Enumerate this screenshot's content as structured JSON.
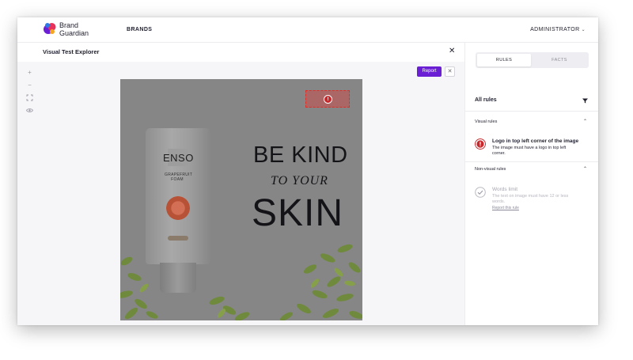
{
  "app": {
    "brand_line1": "Brand",
    "brand_line2": "Guardian",
    "nav_brands": "BRANDS",
    "nav_user": "ADMINISTRATOR"
  },
  "explorer": {
    "title": "Visual Test Explorer",
    "close_glyph": "✕",
    "report_label": "Report",
    "dismiss_glyph": "✕",
    "zoom_tools": [
      "+",
      "−",
      "⛶",
      "👁"
    ]
  },
  "image": {
    "hotspot_badge": "!",
    "headline_1": "BE KIND",
    "headline_2": "TO YOUR",
    "headline_3": "SKIN",
    "product_brand": "ENSO",
    "product_sub": "GRAPEFRUIT FOAM"
  },
  "panel": {
    "tabs": [
      {
        "label": "RULES",
        "active": true
      },
      {
        "label": "FACTS",
        "active": false
      }
    ],
    "all_rules_label": "All rules",
    "visual_section": "Visual rules",
    "nonvisual_section": "Non-visual rules",
    "visual_rules": [
      {
        "title": "Logo in top left corner of the image",
        "description": "The image must have a logo in top left corner.",
        "status": "failed",
        "badge": "!"
      }
    ],
    "nonvisual_rules": [
      {
        "title": "Words limit",
        "description": "The text on image must have 12 or less words.",
        "status": "passed",
        "link": "Report this rule"
      }
    ]
  },
  "colors": {
    "accent": "#6a1fd4",
    "error": "#c7282b",
    "image_overlay": "#868686"
  }
}
